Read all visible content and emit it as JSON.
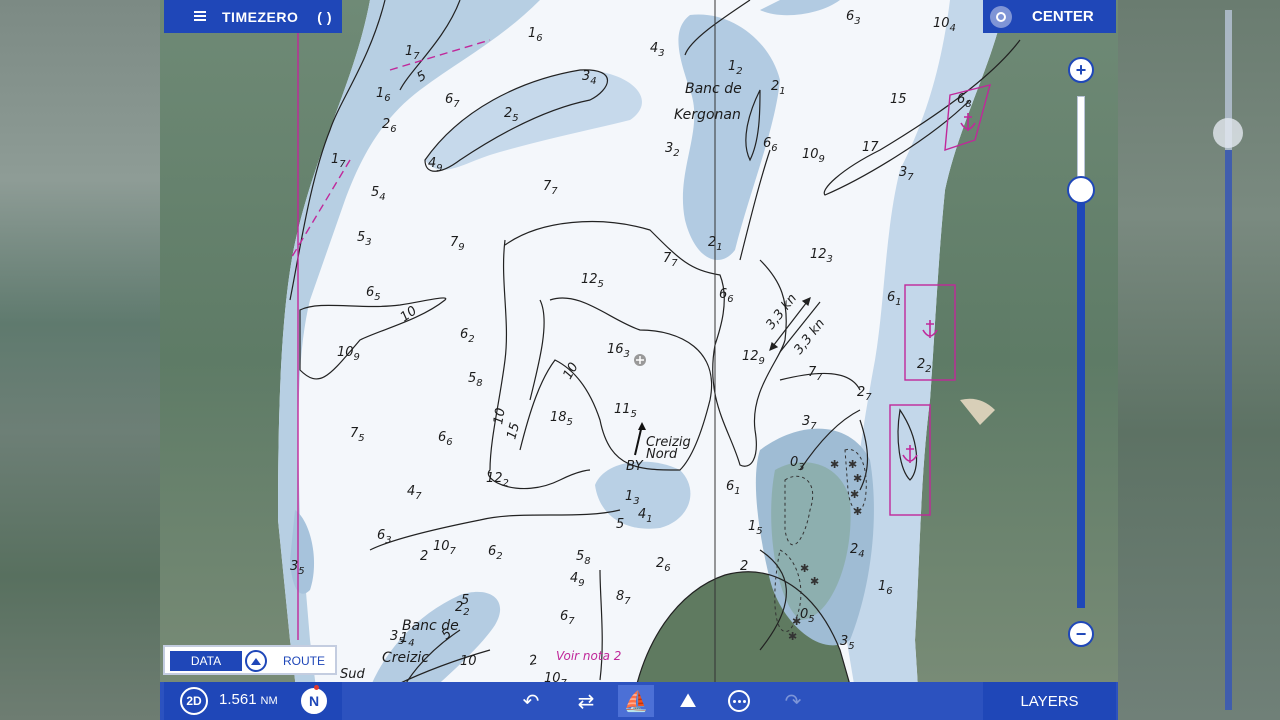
{
  "app": {
    "title": "TIMEZERO"
  },
  "header": {
    "center_label": "CENTER"
  },
  "panel": {
    "data_label": "DATA",
    "route_label": "ROUTE"
  },
  "toolbar": {
    "view_mode": "2D",
    "range_value": "1.561",
    "range_unit": "NM",
    "north_label": "N",
    "layers_label": "LAYERS",
    "icons": [
      "undo-icon",
      "swap-arrows-icon",
      "boat-wake-icon",
      "chart-edit-icon",
      "more-dots-icon",
      "redo-icon"
    ]
  },
  "chart": {
    "places": [
      {
        "name": "Banc de"
      },
      {
        "name": "Kergonan"
      },
      {
        "name": "Banc de"
      },
      {
        "name": "Creizic"
      }
    ],
    "note": "Voir nota 2",
    "buoy": {
      "name_1": "Creizig",
      "name_2": "Nord",
      "code": "BY"
    },
    "current_1": "3,3 kn",
    "current_2": "3,3 kn",
    "south_label": "Sud",
    "soundings": [
      {
        "m": "6",
        "d": "3"
      },
      {
        "m": "10",
        "d": "4"
      },
      {
        "m": "1",
        "d": "6"
      },
      {
        "m": "1",
        "d": "7"
      },
      {
        "m": "4",
        "d": "3"
      },
      {
        "m": "1",
        "d": "2"
      },
      {
        "m": "2",
        "d": "1"
      },
      {
        "m": "3",
        "d": "4"
      },
      {
        "m": "6",
        "d": "7"
      },
      {
        "m": "2",
        "d": "5"
      },
      {
        "m": "1",
        "d": "6"
      },
      {
        "m": "2",
        "d": "6"
      },
      {
        "m": "1",
        "d": "7"
      },
      {
        "m": "4",
        "d": "9"
      },
      {
        "m": "3",
        "d": "2"
      },
      {
        "m": "6",
        "d": "6"
      },
      {
        "m": "10",
        "d": "9"
      },
      {
        "m": "17",
        "d": ""
      },
      {
        "m": "15",
        "d": ""
      },
      {
        "m": "6",
        "d": "8"
      },
      {
        "m": "7",
        "d": "7"
      },
      {
        "m": "5",
        "d": "4"
      },
      {
        "m": "5",
        "d": "3"
      },
      {
        "m": "7",
        "d": "9"
      },
      {
        "m": "2",
        "d": "1"
      },
      {
        "m": "3",
        "d": "7"
      },
      {
        "m": "7",
        "d": "7"
      },
      {
        "m": "12",
        "d": "3"
      },
      {
        "m": "6",
        "d": "5"
      },
      {
        "m": "12",
        "d": "5"
      },
      {
        "m": "6",
        "d": "6"
      },
      {
        "m": "6",
        "d": "1"
      },
      {
        "m": "10",
        "d": "9"
      },
      {
        "m": "6",
        "d": "2"
      },
      {
        "m": "16",
        "d": "3"
      },
      {
        "m": "12",
        "d": "9"
      },
      {
        "m": "2",
        "d": "2"
      },
      {
        "m": "5",
        "d": "8"
      },
      {
        "m": "7",
        "d": "7"
      },
      {
        "m": "2",
        "d": "7"
      },
      {
        "m": "7",
        "d": "5"
      },
      {
        "m": "6",
        "d": "6"
      },
      {
        "m": "18",
        "d": "5"
      },
      {
        "m": "11",
        "d": "5"
      },
      {
        "m": "3",
        "d": "7"
      },
      {
        "m": "4",
        "d": "7"
      },
      {
        "m": "12",
        "d": "2"
      },
      {
        "m": "1",
        "d": "3"
      },
      {
        "m": "4",
        "d": "1"
      },
      {
        "m": "6",
        "d": "1"
      },
      {
        "m": "6",
        "d": "3"
      },
      {
        "m": "10",
        "d": "7"
      },
      {
        "m": "6",
        "d": "2"
      },
      {
        "m": "5",
        "d": "8"
      },
      {
        "m": "2",
        "d": "6"
      },
      {
        "m": "2",
        "d": "4"
      },
      {
        "m": "3",
        "d": "5"
      },
      {
        "m": "4",
        "d": "9"
      },
      {
        "m": "8",
        "d": "7"
      },
      {
        "m": "1",
        "d": "6"
      },
      {
        "m": "6",
        "d": "7"
      },
      {
        "m": "2",
        "d": "2"
      },
      {
        "m": "3",
        "d": "5"
      },
      {
        "m": "1",
        "d": "5"
      },
      {
        "m": "0",
        "d": "5"
      },
      {
        "m": "3",
        "d": "5"
      },
      {
        "m": "10",
        "d": "7"
      },
      {
        "m": "3",
        "d": "8"
      },
      {
        "m": "1",
        "d": "4"
      },
      {
        "m": "0",
        "d": "3"
      }
    ],
    "contour_labels": [
      "5",
      "10",
      "10",
      "15",
      "10",
      "5",
      "5",
      "2",
      "5",
      "2",
      "10",
      "2"
    ]
  }
}
